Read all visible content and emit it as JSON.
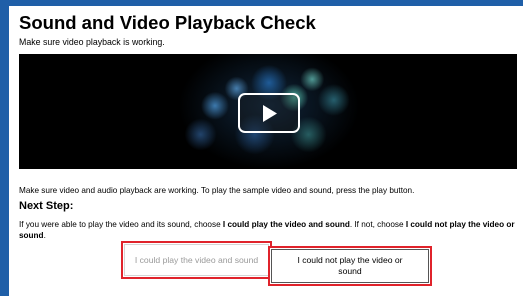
{
  "page": {
    "title": "Sound and Video Playback Check",
    "subtitle": "Make sure video playback is working."
  },
  "video": {
    "play_icon": "play-icon"
  },
  "instructions": "Make sure video and audio playback are working. To play the sample video and sound, press the play button.",
  "next_step": {
    "heading": "Next Step:",
    "text_1": "If you were able to play the video and its sound, choose ",
    "bold_1": "I could play the video and sound",
    "text_2": ". If not, choose ",
    "bold_2": "I could not play the video or sound",
    "text_3": "."
  },
  "buttons": {
    "could_play": "I could play the video and sound",
    "could_not_play": "I could not play the video or sound"
  },
  "colors": {
    "background": "#1f5fa8",
    "highlight_border": "#e0232b"
  }
}
